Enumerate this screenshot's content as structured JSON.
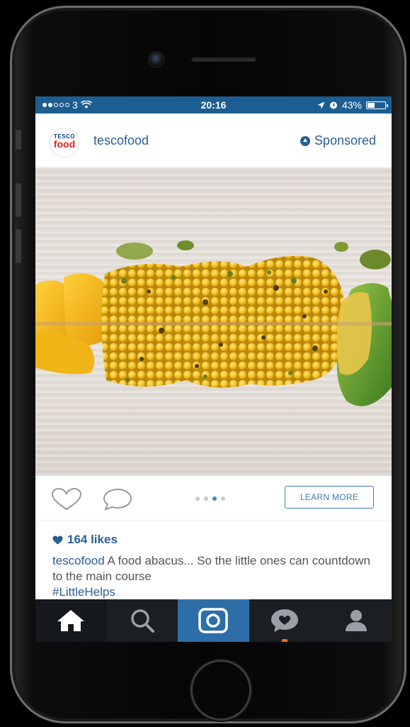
{
  "status_bar": {
    "carrier": "3",
    "time": "20:16",
    "battery": "43%",
    "battery_level": 0.43
  },
  "post": {
    "avatar_brand_line1": "TESCO",
    "avatar_brand_line2": "food",
    "username": "tescofood",
    "sponsored_label": "Sponsored",
    "cta_label": "LEARN MORE",
    "likes": "164 likes",
    "caption_username": "tescofood",
    "caption_text": " A food abacus... So the little ones can countdown to the main course",
    "hashtag": "#LittleHelps",
    "carousel_total": 4,
    "carousel_active": 3
  },
  "colors": {
    "status_bar": "#1d5e92",
    "link_blue": "#2a5f93",
    "tab_bar": "#1b1e22",
    "tab_active": "#2d6ea8",
    "corn": "#f2c21c"
  },
  "icons": {
    "tabs": [
      "home-icon",
      "search-icon",
      "camera-icon",
      "activity-icon",
      "profile-icon"
    ]
  }
}
